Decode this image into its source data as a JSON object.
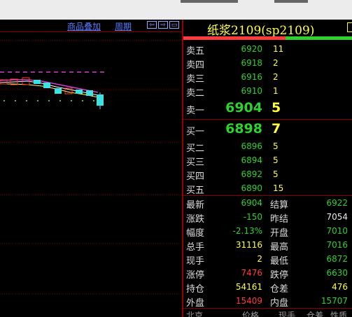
{
  "chart": {
    "overlay_label": "商品叠加",
    "period_label": "周期",
    "nav_buttons": [
      "⇦",
      "⇨",
      "▭"
    ]
  },
  "quote": {
    "title": "纸浆2109(sp2109)",
    "sells": [
      {
        "label": "卖五",
        "price": "6920",
        "vol": "11"
      },
      {
        "label": "卖四",
        "price": "6918",
        "vol": "2"
      },
      {
        "label": "卖三",
        "price": "6916",
        "vol": "2"
      },
      {
        "label": "卖二",
        "price": "6910",
        "vol": "1"
      },
      {
        "label": "卖一",
        "price": "6904",
        "vol": "5"
      }
    ],
    "buys": [
      {
        "label": "买一",
        "price": "6898",
        "vol": "7"
      },
      {
        "label": "买二",
        "price": "6896",
        "vol": "5"
      },
      {
        "label": "买三",
        "price": "6894",
        "vol": "5"
      },
      {
        "label": "买四",
        "price": "6892",
        "vol": "5"
      },
      {
        "label": "买五",
        "price": "6890",
        "vol": "15"
      }
    ],
    "stats": [
      {
        "l1": "最新",
        "v1": "6904",
        "l2": "结算",
        "v2": "6922"
      },
      {
        "l1": "涨跌",
        "v1": "-150",
        "l2": "昨结",
        "v2": "7054"
      },
      {
        "l1": "幅度",
        "v1": "-2.13%",
        "l2": "开盘",
        "v2": "7010"
      },
      {
        "l1": "总手",
        "v1": "31116",
        "l2": "最高",
        "v2": "7016"
      },
      {
        "l1": "现手",
        "v1": "2",
        "l2": "最低",
        "v2": "6872"
      },
      {
        "l1": "涨停",
        "v1": "7476",
        "l2": "跌停",
        "v2": "6630"
      },
      {
        "l1": "持仓",
        "v1": "54161",
        "l2": "仓差",
        "v2": "476"
      },
      {
        "l1": "外盘",
        "v1": "15409",
        "l2": "内盘",
        "v2": "15707"
      }
    ],
    "footer_labels": [
      "北京",
      "价格",
      "现手",
      "仓差",
      "性质"
    ]
  },
  "colors": {
    "green": "#2fd12f",
    "red": "#ff3c3c",
    "yellow": "#ffff3c",
    "white": "#eaeaea",
    "border": "#8a0000"
  }
}
